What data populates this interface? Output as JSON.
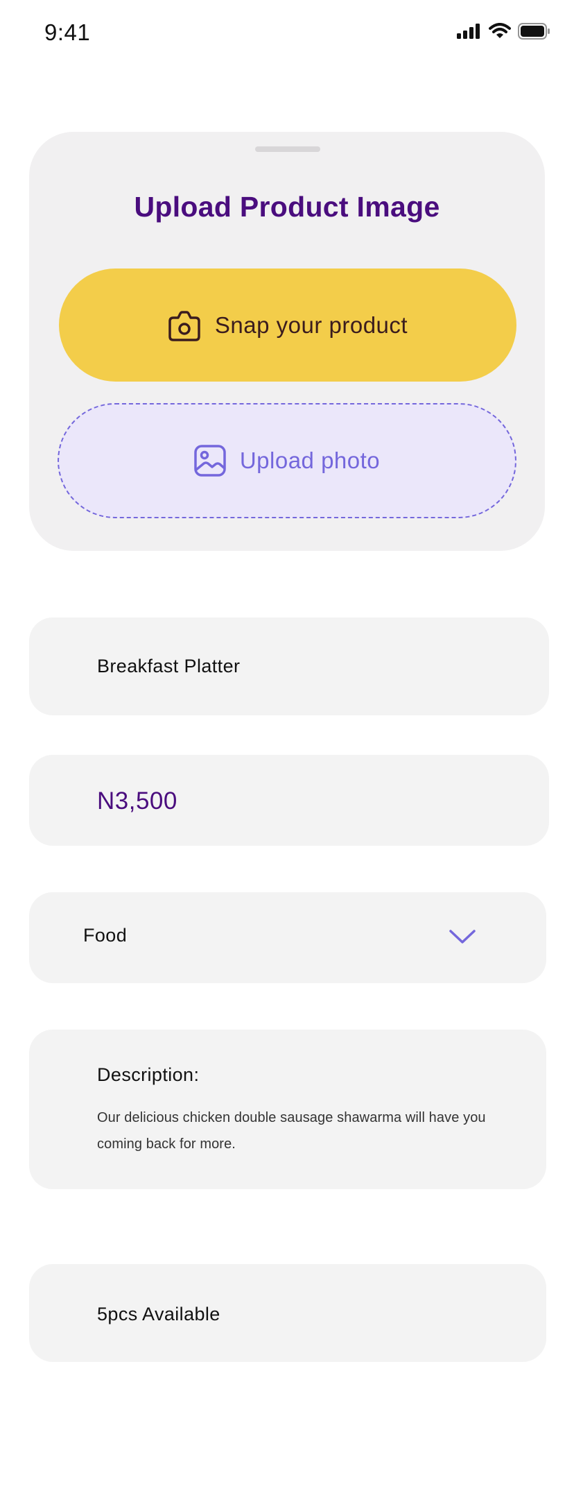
{
  "status_bar": {
    "time": "9:41"
  },
  "upload_section": {
    "title": "Upload Product Image",
    "snap_button_label": "Snap your product",
    "upload_button_label": "Upload photo"
  },
  "product": {
    "name": "Breakfast Platter",
    "price": "N3,500",
    "category": "Food",
    "description_label": "Description:",
    "description": "Our delicious chicken double sausage shawarma will have you coming back for more.",
    "stock": "5pcs Available"
  },
  "colors": {
    "brand_purple": "#4a0d7e",
    "accent_yellow": "#f3cd4a",
    "accent_lilac": "#7467dc",
    "upload_bg": "#ebe7fa",
    "card_bg": "#f1f0f1",
    "field_bg": "#f3f3f3"
  },
  "icons": {
    "snap": "camera-icon",
    "upload": "image-icon",
    "category": "chevron-down-icon",
    "signal": "signal-icon",
    "wifi": "wifi-icon",
    "battery": "battery-icon"
  }
}
